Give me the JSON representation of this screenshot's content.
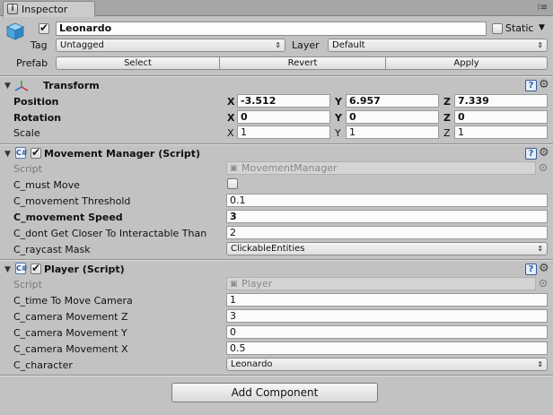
{
  "tab": {
    "title": "Inspector"
  },
  "object": {
    "name": "Leonardo",
    "static_label": "Static",
    "tag_label": "Tag",
    "tag_value": "Untagged",
    "layer_label": "Layer",
    "layer_value": "Default",
    "prefab_label": "Prefab",
    "prefab_buttons": [
      "Select",
      "Revert",
      "Apply"
    ]
  },
  "transform": {
    "title": "Transform",
    "rows": [
      {
        "label": "Position",
        "x": "-3.512",
        "y": "6.957",
        "z": "7.339"
      },
      {
        "label": "Rotation",
        "x": "0",
        "y": "0",
        "z": "0"
      },
      {
        "label": "Scale",
        "x": "1",
        "y": "1",
        "z": "1"
      }
    ],
    "axes": [
      "X",
      "Y",
      "Z"
    ]
  },
  "movement_manager": {
    "title": "Movement Manager (Script)",
    "script_label": "Script",
    "script_value": "MovementManager",
    "fields": [
      {
        "label": "C_must Move",
        "type": "checkbox",
        "checked": false
      },
      {
        "label": "C_movement Threshold",
        "value": "0.1"
      },
      {
        "label": "C_movement Speed",
        "value": "3"
      },
      {
        "label": "C_dont Get Closer To Interactable Than",
        "value": "2"
      },
      {
        "label": "C_raycast Mask",
        "value": "ClickableEntities"
      }
    ]
  },
  "player": {
    "title": "Player (Script)",
    "script_label": "Script",
    "script_value": "Player",
    "fields": [
      {
        "label": "C_time To Move Camera",
        "value": "1"
      },
      {
        "label": "C_camera Movement Z",
        "value": "3"
      },
      {
        "label": "C_camera Movement Y",
        "value": "0"
      },
      {
        "label": "C_camera Movement X",
        "value": "0.5"
      },
      {
        "label": "C_character",
        "value": "Leonardo"
      }
    ]
  },
  "add_component_label": "Add Component",
  "icons": [
    "inspector-icon",
    "menu-icon",
    "gameobject-cube-icon",
    "transform-icon",
    "help-icon",
    "gear-icon",
    "script-icon",
    "object-picker-icon"
  ]
}
